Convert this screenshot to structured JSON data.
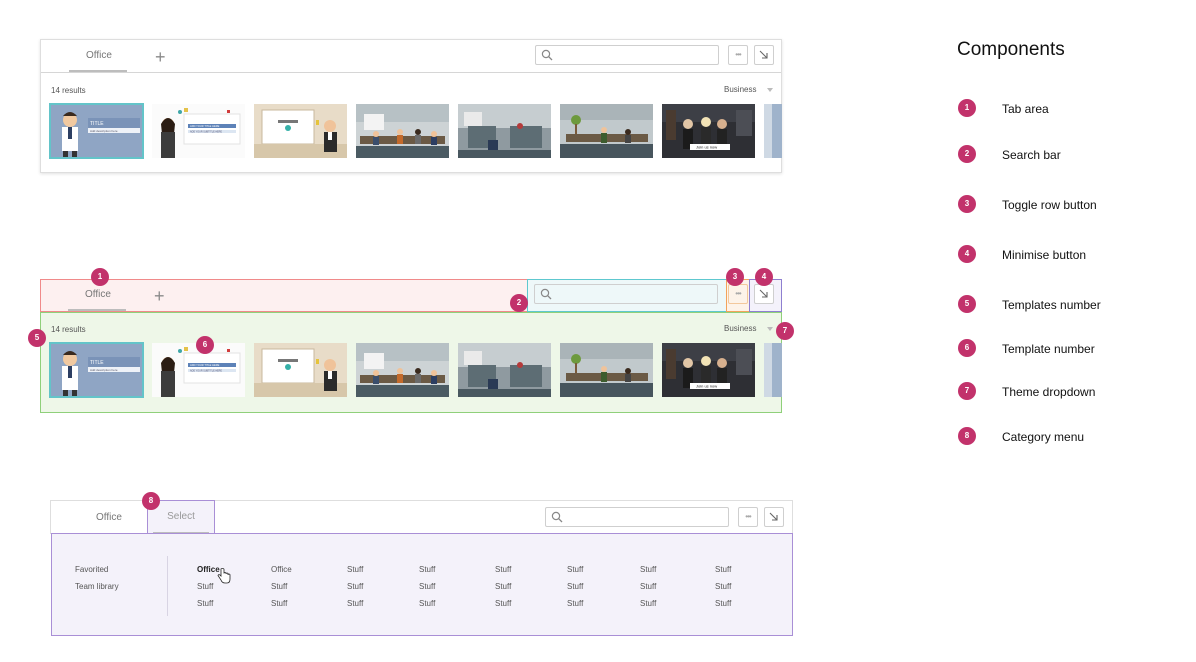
{
  "panel1": {
    "tab_label": "Office",
    "plus": "+",
    "results": "14 results",
    "theme": "Business",
    "dots": "•••"
  },
  "panel2": {
    "tab_label": "Office",
    "plus": "+",
    "results": "14 results",
    "theme": "Business",
    "dots": "•••",
    "badges": [
      "1",
      "2",
      "3",
      "4",
      "5",
      "6",
      "7"
    ]
  },
  "panel3": {
    "tab_office": "Office",
    "tab_select": "Select",
    "dots": "•••",
    "badge": "8",
    "side_items": [
      "Favorited",
      "Team library"
    ],
    "columns": [
      [
        "Office",
        "Stuff",
        "Stuff"
      ],
      [
        "Office",
        "Stuff",
        "Stuff"
      ],
      [
        "Stuff",
        "Stuff",
        "Stuff"
      ],
      [
        "Stuff",
        "Stuff",
        "Stuff"
      ],
      [
        "Stuff",
        "Stuff",
        "Stuff"
      ],
      [
        "Stuff",
        "Stuff",
        "Stuff"
      ],
      [
        "Stuff",
        "Stuff",
        "Stuff"
      ],
      [
        "Stuff",
        "Stuff",
        "Stuff"
      ]
    ]
  },
  "thumb_card_text": {
    "title": "TITLE",
    "description": "Add description here",
    "add_title": "ADD YOUR TITLE HERE",
    "add_subtitle": "ADD YOUR SUBTITLE HERE",
    "join": "Join us now"
  },
  "legend": {
    "title": "Components",
    "items": [
      {
        "num": "1",
        "label": "Tab area"
      },
      {
        "num": "2",
        "label": "Search bar"
      },
      {
        "num": "3",
        "label": "Toggle row button"
      },
      {
        "num": "4",
        "label": "Minimise button"
      },
      {
        "num": "5",
        "label": "Templates number"
      },
      {
        "num": "6",
        "label": "Template number"
      },
      {
        "num": "7",
        "label": "Theme dropdown"
      },
      {
        "num": "8",
        "label": "Category menu"
      }
    ]
  },
  "colors": {
    "badge": "#c2326b",
    "tab_area": "#f08a8a",
    "search_area": "#5ec8cf",
    "toggle_area": "#f3a35b",
    "minimise_area": "#8e7fd0",
    "templates_area": "#8fd07a",
    "category_menu": "#a98fd6"
  }
}
